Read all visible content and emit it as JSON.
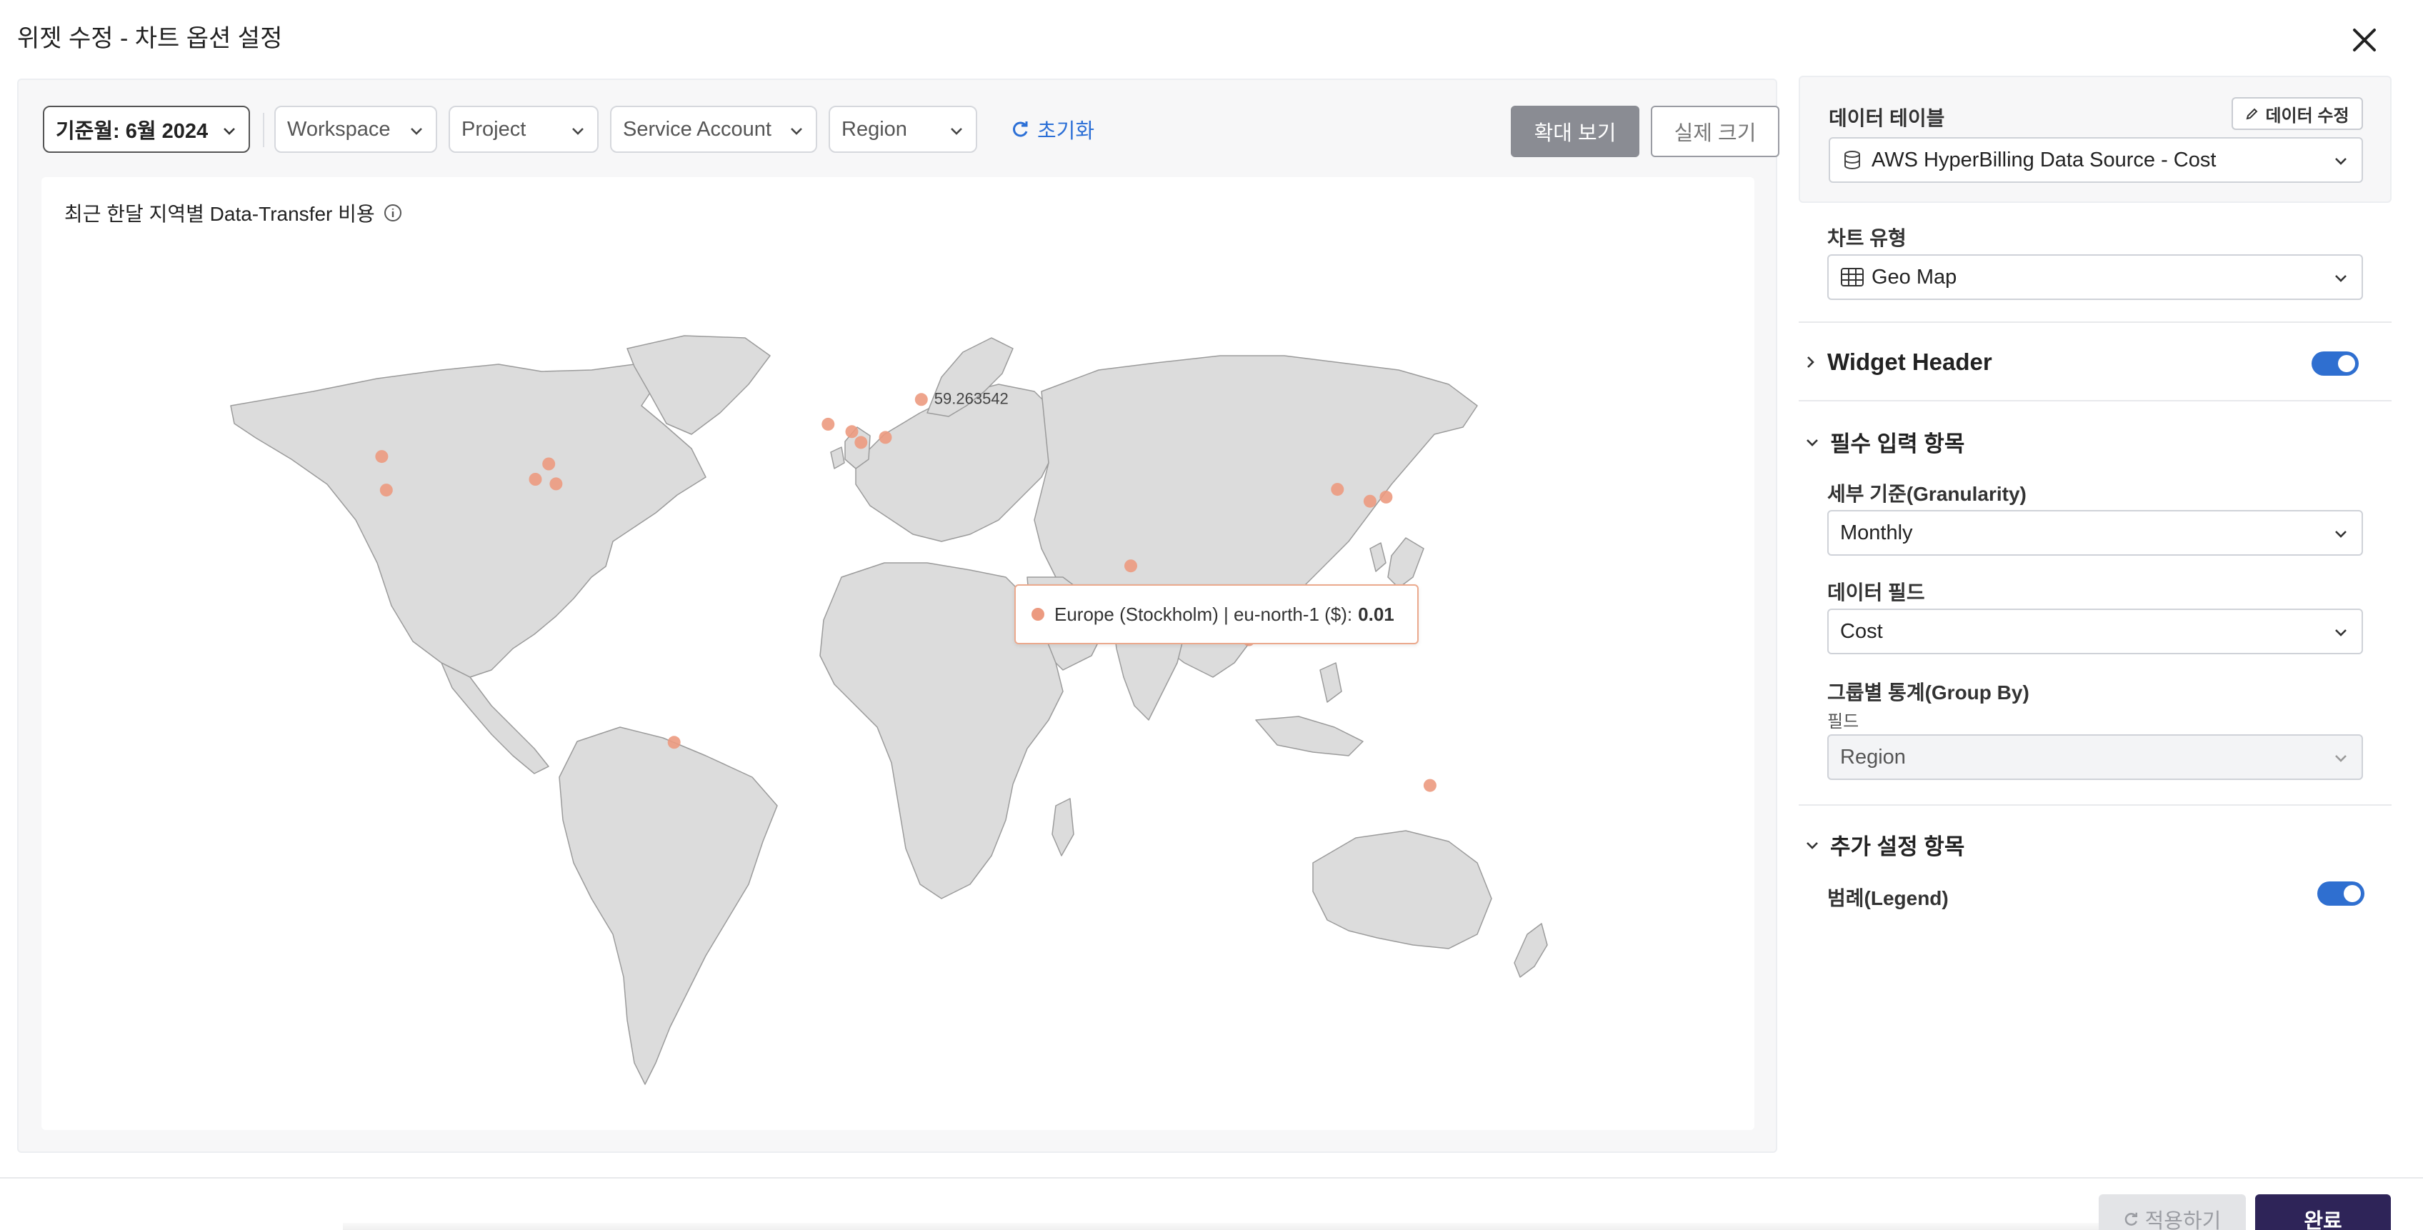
{
  "modal": {
    "title": "위젯 수정 - 차트 옵션 설정",
    "close_label": "×"
  },
  "filters": {
    "period": "기준월: 6월 2024",
    "workspace": "Workspace",
    "project": "Project",
    "service_account": "Service Account",
    "region": "Region",
    "reset": "초기화"
  },
  "view_buttons": {
    "zoom": "확대 보기",
    "actual_size": "실제 크기"
  },
  "widget": {
    "title": "최근 한달 지역별 Data-Transfer 비용",
    "point_value_label": "59.263542",
    "tooltip": {
      "region": "Europe (Stockholm) | eu-north-1 ($):",
      "value": "0.01"
    }
  },
  "chart_data": {
    "type": "geo-map",
    "title": "최근 한달 지역별 Data-Transfer 비용",
    "marker_color": "#ec9a80",
    "points": [
      {
        "lon": -123.1,
        "lat": 45.5
      },
      {
        "lon": -121.9,
        "lat": 37.4
      },
      {
        "lon": -82.9,
        "lat": 40.0
      },
      {
        "lon": -79.4,
        "lat": 43.7
      },
      {
        "lon": -77.5,
        "lat": 38.9
      },
      {
        "lon": -6.3,
        "lat": 53.3
      },
      {
        "lon": -0.1,
        "lat": 51.5
      },
      {
        "lon": 2.3,
        "lat": 48.9
      },
      {
        "lon": 8.7,
        "lat": 50.1
      },
      {
        "lon": 18.1,
        "lat": 59.263542,
        "label": "59.263542"
      },
      {
        "lon": 72.9,
        "lat": 19.1
      },
      {
        "lon": 103.8,
        "lat": 1.3
      },
      {
        "lon": 126.98,
        "lat": 37.57
      },
      {
        "lon": 135.5,
        "lat": 34.7
      },
      {
        "lon": 139.7,
        "lat": 35.7
      },
      {
        "lon": -46.6,
        "lat": -23.5
      },
      {
        "lon": 151.2,
        "lat": -33.9
      }
    ]
  },
  "data_table": {
    "label": "데이터 테이블",
    "edit_button": "데이터 수정",
    "value": "AWS HyperBilling Data Source - Cost"
  },
  "chart_type": {
    "label": "차트 유형",
    "value": "Geo Map"
  },
  "widget_header": {
    "label": "Widget Header",
    "enabled": true
  },
  "required_section": {
    "label": "필수 입력 항목",
    "granularity_label": "세부 기준(Granularity)",
    "granularity_value": "Monthly",
    "data_field_label": "데이터 필드",
    "data_field_value": "Cost",
    "group_by_label": "그룹별 통계(Group By)",
    "group_by_sub": "필드",
    "group_by_value": "Region"
  },
  "extra_section": {
    "label": "추가 설정 항목",
    "legend_label": "범례(Legend)",
    "legend_enabled": true
  },
  "footer": {
    "apply": "적용하기",
    "done": "완료"
  },
  "colors": {
    "accent": "#2f6fd0",
    "primary_dark": "#2e2458",
    "marker": "#ec9a80",
    "land": "#dcdcdc"
  }
}
